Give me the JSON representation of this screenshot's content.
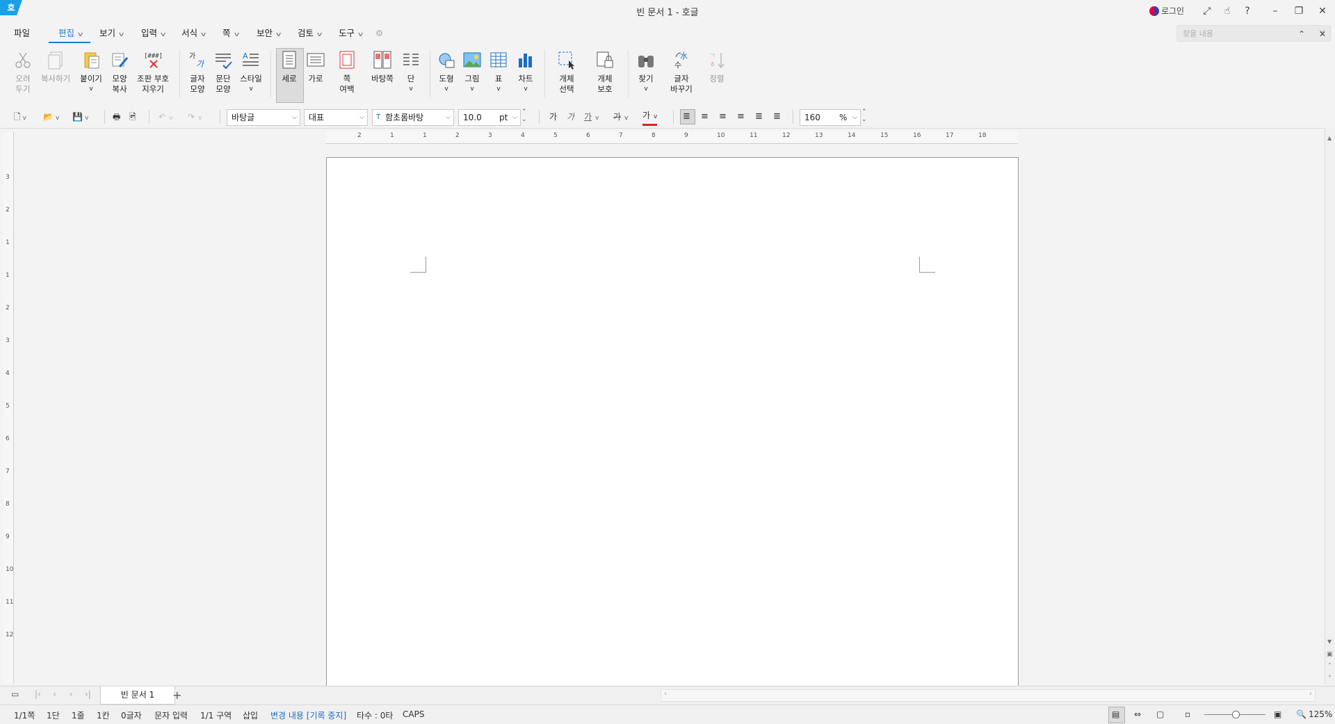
{
  "window": {
    "title": "빈 문서 1 - 호글",
    "logo": "호"
  },
  "titlebar": {
    "login_label": "로그인"
  },
  "menu": {
    "file": "파일",
    "tabs": [
      "편집",
      "보기",
      "입력",
      "서식",
      "쪽",
      "보안",
      "검토",
      "도구"
    ]
  },
  "search": {
    "placeholder": "찾을 내용"
  },
  "ribbon": {
    "cut": [
      "오려",
      "두기"
    ],
    "copy": [
      "복사하기"
    ],
    "paste": [
      "붙이기"
    ],
    "format_copy": [
      "모양",
      "복사"
    ],
    "clear_codes": [
      "조판 부호",
      "지우기"
    ],
    "char_shape": [
      "글자",
      "모양"
    ],
    "para_shape": [
      "문단",
      "모양"
    ],
    "style": [
      "스타일"
    ],
    "portrait": [
      "세로"
    ],
    "landscape": [
      "가로"
    ],
    "page_margin": [
      "쪽",
      "여백"
    ],
    "master_page": [
      "바탕쪽"
    ],
    "columns": [
      "단"
    ],
    "shape": [
      "도형"
    ],
    "picture": [
      "그림"
    ],
    "table": [
      "표"
    ],
    "chart": [
      "차트"
    ],
    "select_object": [
      "개체",
      "선택"
    ],
    "protect_object": [
      "개체",
      "보호"
    ],
    "find": [
      "찾기"
    ],
    "replace": [
      "글자",
      "바꾸기"
    ],
    "sort": [
      "정렬"
    ]
  },
  "toolbar": {
    "style_combo": "바탕글",
    "lang_combo": "대표",
    "font_combo": "함초롬바탕",
    "font_size": "10.0",
    "font_unit": "pt",
    "line_spacing": "160",
    "line_spacing_unit": "%"
  },
  "ruler": {
    "h_numbers": [
      "2",
      "1",
      "1",
      "2",
      "3",
      "4",
      "5",
      "6",
      "7",
      "8",
      "9",
      "10",
      "11",
      "12",
      "13",
      "14",
      "15",
      "16",
      "17",
      "18"
    ],
    "v_numbers": [
      "3",
      "2",
      "1",
      "1",
      "2",
      "3",
      "4",
      "5",
      "6",
      "7",
      "8",
      "9",
      "10",
      "11",
      "12"
    ]
  },
  "doc_tab": {
    "label": "빈 문서 1"
  },
  "status": {
    "page": "1/1쪽",
    "column": "1단",
    "line": "1줄",
    "col": "1칸",
    "chars": "0글자",
    "mode": "문자 입력",
    "section": "1/1 구역",
    "insert": "삽입",
    "track": "변경 내용 [기록 중지]",
    "typing": "타수 : 0타",
    "caps": "CAPS",
    "zoom": "125%"
  },
  "colors": {
    "accent": "#1a7fd6",
    "logo_bg": "#1aa0e6"
  }
}
